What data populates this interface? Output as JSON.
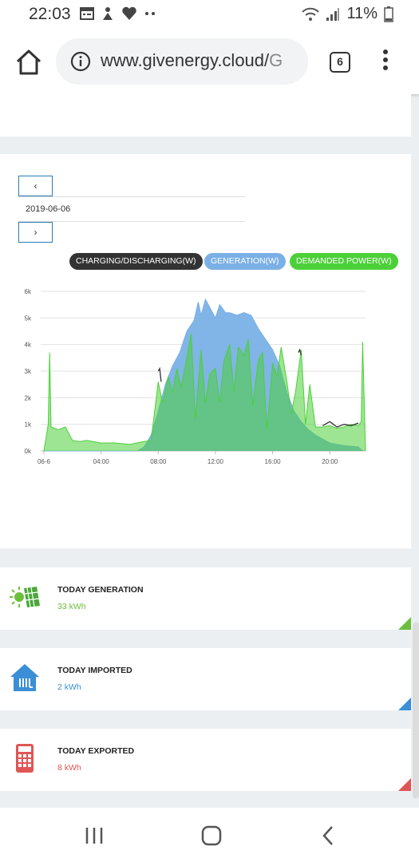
{
  "status_bar": {
    "time": "22:03",
    "battery": "11%",
    "icons": [
      "calendar-icon",
      "person-icon",
      "heart-icon",
      "dots-icon",
      "wifi-icon",
      "signal-icon",
      "battery-icon"
    ]
  },
  "browser": {
    "url": "www.givenergy.cloud/",
    "url_tail": "G",
    "tab_count": "6"
  },
  "date_nav": {
    "prev_label": "‹",
    "next_label": "›",
    "date": "2019-06-06"
  },
  "legend": {
    "charging": "CHARGING/DISCHARGING(W)",
    "generation": "GENERATION(W)",
    "demanded": "DEMANDED POWER(W)"
  },
  "colors": {
    "charging": "#333333",
    "generation": "#7ab0e6",
    "demanded": "#4cd039",
    "imported": "#3a8fd6",
    "exported": "#e05555"
  },
  "chart_data": {
    "type": "area",
    "x_tick_labels": [
      "06-6",
      "04:00",
      "08:00",
      "12:00",
      "16:00",
      "20:00"
    ],
    "y_tick_labels": [
      "0k",
      "1k",
      "2k",
      "3k",
      "4k",
      "5k",
      "6k"
    ],
    "ylim": [
      0,
      6000
    ],
    "xlim_hours": [
      0,
      22.5
    ],
    "grid": true,
    "legend_position": "top",
    "series": [
      {
        "name": "GENERATION(W)",
        "x": [
          0,
          6.5,
          7.0,
          7.5,
          8.0,
          8.5,
          9.0,
          9.5,
          10.0,
          10.5,
          10.8,
          11.0,
          11.3,
          11.6,
          12.0,
          12.3,
          12.7,
          13.0,
          13.5,
          14.0,
          14.5,
          15.0,
          15.5,
          16.0,
          16.5,
          17.0,
          17.5,
          18.0,
          18.5,
          19.0,
          20.0,
          21.0,
          22.0,
          22.3
        ],
        "y": [
          0,
          0,
          150,
          600,
          1500,
          2500,
          3200,
          3700,
          4500,
          4900,
          5600,
          5100,
          5700,
          5400,
          5000,
          5500,
          5200,
          5200,
          5100,
          5200,
          5100,
          4600,
          4200,
          3800,
          3200,
          2200,
          1500,
          1100,
          800,
          600,
          300,
          200,
          150,
          0
        ]
      },
      {
        "name": "DEMANDED POWER(W)",
        "x": [
          0,
          0.3,
          0.4,
          0.5,
          1.0,
          1.5,
          2.0,
          2.5,
          3.0,
          4.0,
          5.0,
          6.0,
          7.0,
          7.5,
          8.0,
          8.3,
          8.7,
          9.0,
          9.3,
          9.6,
          10.0,
          10.3,
          10.6,
          11.0,
          11.3,
          11.6,
          12.0,
          12.3,
          12.6,
          13.0,
          13.3,
          13.6,
          14.0,
          14.3,
          14.6,
          15.0,
          15.3,
          15.6,
          16.0,
          16.3,
          16.6,
          17.0,
          17.3,
          17.6,
          18.0,
          18.3,
          18.6,
          19.0,
          19.5,
          20.0,
          20.5,
          21.0,
          21.5,
          22.0,
          22.2,
          22.3,
          22.5
        ],
        "y": [
          0,
          1000,
          3700,
          900,
          800,
          900,
          400,
          350,
          400,
          300,
          300,
          250,
          350,
          400,
          2600,
          1800,
          2800,
          2200,
          3100,
          2400,
          3500,
          4400,
          1200,
          3800,
          1800,
          2900,
          3100,
          1800,
          3400,
          4000,
          2200,
          3900,
          3600,
          4200,
          1700,
          3400,
          3700,
          800,
          3300,
          2800,
          3900,
          2600,
          1400,
          2200,
          3800,
          1000,
          2500,
          900,
          900,
          950,
          850,
          900,
          1000,
          950,
          1100,
          4100,
          0
        ]
      },
      {
        "name": "CHARGING/DISCHARGING(W)",
        "x": [
          8.0,
          8.1,
          8.2,
          17.8,
          17.9,
          18.0,
          19.5,
          20.0,
          20.5,
          21.0,
          21.5,
          22.0
        ],
        "y": [
          3000,
          3100,
          2600,
          3700,
          3800,
          3600,
          950,
          1100,
          900,
          1000,
          950,
          1050
        ]
      }
    ]
  },
  "stats": [
    {
      "title": "TODAY GENERATION",
      "value": "33 kWh"
    },
    {
      "title": "TODAY IMPORTED",
      "value": "2 kWh"
    },
    {
      "title": "TODAY EXPORTED",
      "value": "8 kWh"
    }
  ]
}
